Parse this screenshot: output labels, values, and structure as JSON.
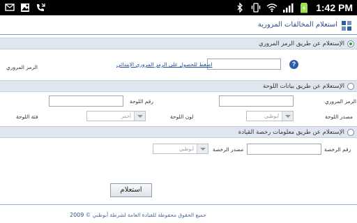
{
  "statusbar": {
    "time": "1:42 PM",
    "icons": [
      "sms-icon",
      "image-icon",
      "phone-missed-icon",
      "bluetooth-icon",
      "vibrate-icon",
      "wifi-icon",
      "signal-icon",
      "battery-charging-icon"
    ]
  },
  "header": {
    "title": "استعلام المخالفات المرورية",
    "icon": "grid-icon"
  },
  "section1": {
    "label": "الإستعلام عن طريق الرمز المروري",
    "selected": true,
    "code_label": "الرمز المروري",
    "code_value": "",
    "link_text": "اضغط للحصول على الرمز المروري الإبتدائي",
    "help_icon": "?"
  },
  "section2": {
    "label": "الإستعلام عن طريق بيانات اللوحة",
    "selected": false,
    "code_label": "الرمز المروري",
    "plate_number_label": "رقم اللوحة",
    "plate_source_label": "مصدر اللوحة",
    "plate_source_value": "أبوظبي",
    "plate_color_label": "لون اللوحة",
    "plate_color_value": "أحمر",
    "plate_category_label": "فئة اللوحة"
  },
  "section3": {
    "label": "الإستعلام عن طريق معلومات رخصة القيادة",
    "selected": false,
    "license_number_label": "رقم الرخصة",
    "license_source_label": "مصدر الرخصة",
    "license_source_value": "أبوظبي"
  },
  "submit_label": "استعلام",
  "footer": {
    "text": "جميع الحقوق محفوظة للقيادة العامة لشرطة أبوظبي ©",
    "year": "2009"
  }
}
